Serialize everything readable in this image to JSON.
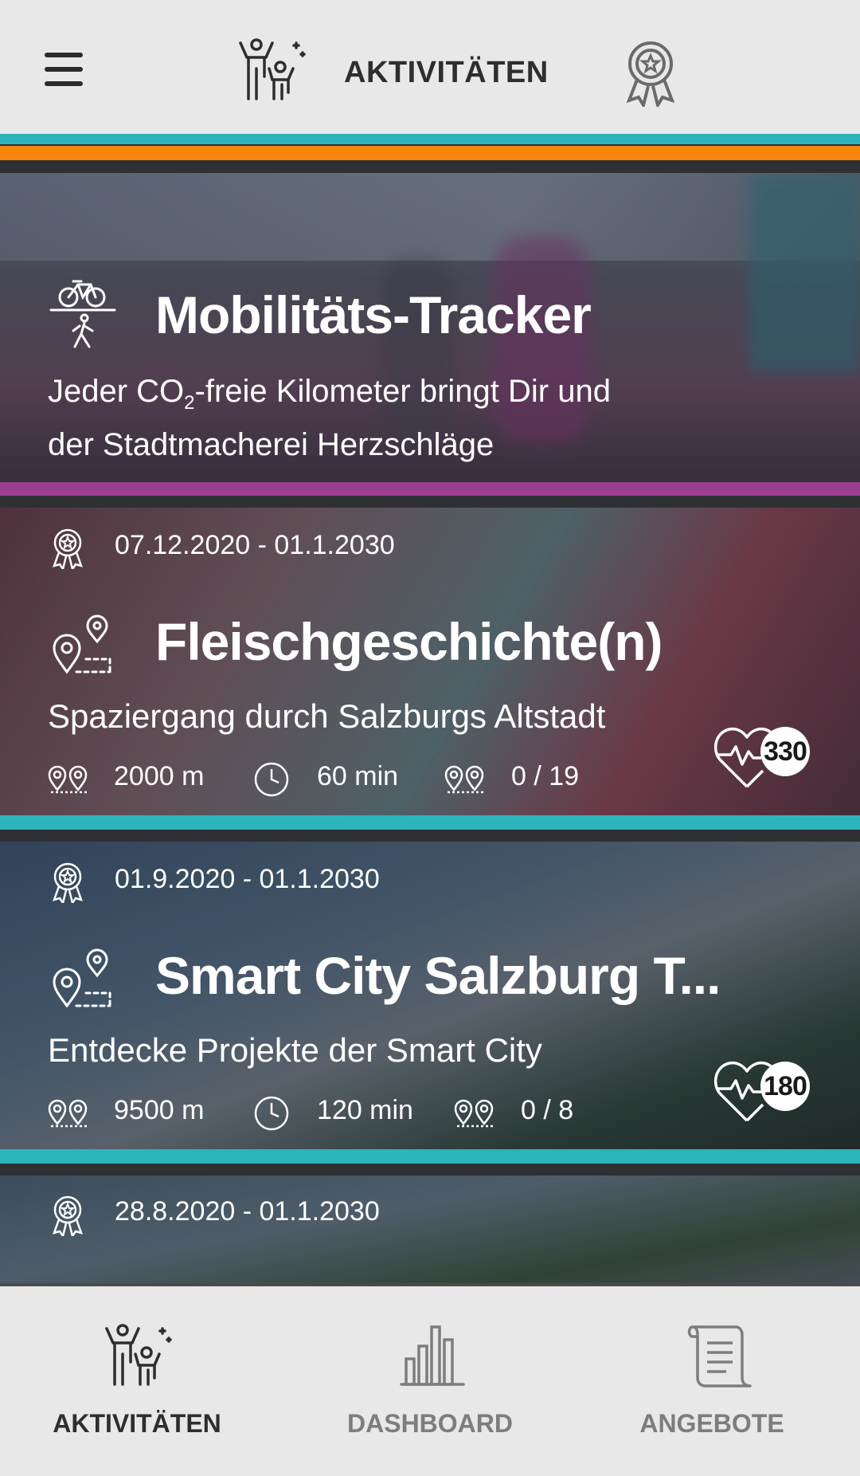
{
  "header": {
    "title": "AKTIVITÄTEN",
    "menu_icon": "hamburger-menu-icon",
    "logo_icon": "people-celebrating-icon",
    "award_icon": "award-medal-icon"
  },
  "colors": {
    "teal": "#2bb5bb",
    "orange": "#f7850e",
    "purple": "#9b3e8d",
    "header_bg": "#e8e8e8",
    "nav_active": "#2e2e2e",
    "nav_inactive": "#7d7d7d"
  },
  "hero": {
    "title": "Mobilitäts-Tracker",
    "subtitle_line1_pre": "Jeder CO",
    "subtitle_line1_sub": "2",
    "subtitle_line1_post": "-freie Kilometer bringt Dir und",
    "subtitle_line2": "der Stadtmacherei Herzschläge",
    "icon": "bike-walk-icon"
  },
  "cards": [
    {
      "date": "07.12.2020 - 01.1.2030",
      "title": "Fleischgeschichte(n)",
      "subtitle": "Spaziergang durch Salzburgs Altstadt",
      "distance": "2000 m",
      "duration": "60 min",
      "progress": "0 / 19",
      "hearts": "330"
    },
    {
      "date": "01.9.2020 - 01.1.2030",
      "title": "Smart City Salzburg T...",
      "subtitle": "Entdecke Projekte der Smart City",
      "distance": "9500 m",
      "duration": "120 min",
      "progress": "0 / 8",
      "hearts": "180"
    },
    {
      "date": "28.8.2020 - 01.1.2030"
    }
  ],
  "bottom_nav": {
    "items": [
      {
        "label": "AKTIVITÄTEN",
        "icon": "people-celebrating-icon",
        "active": true
      },
      {
        "label": "DASHBOARD",
        "icon": "bar-chart-icon",
        "active": false
      },
      {
        "label": "ANGEBOTE",
        "icon": "scroll-icon",
        "active": false
      }
    ]
  }
}
